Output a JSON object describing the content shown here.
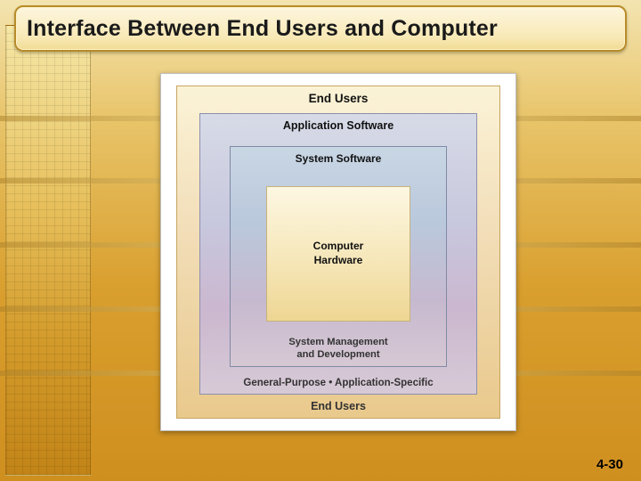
{
  "title": "Interface Between End Users and Computer",
  "page_number": "4-30",
  "diagram": {
    "end_users_top": "End Users",
    "end_users_bottom": "End Users",
    "app_top": "Application Software",
    "app_bottom": "General-Purpose  •  Application-Specific",
    "sys_top": "System Software",
    "sys_bottom_line1": "System Management",
    "sys_bottom_line2": "and Development",
    "hardware_line1": "Computer",
    "hardware_line2": "Hardware"
  }
}
